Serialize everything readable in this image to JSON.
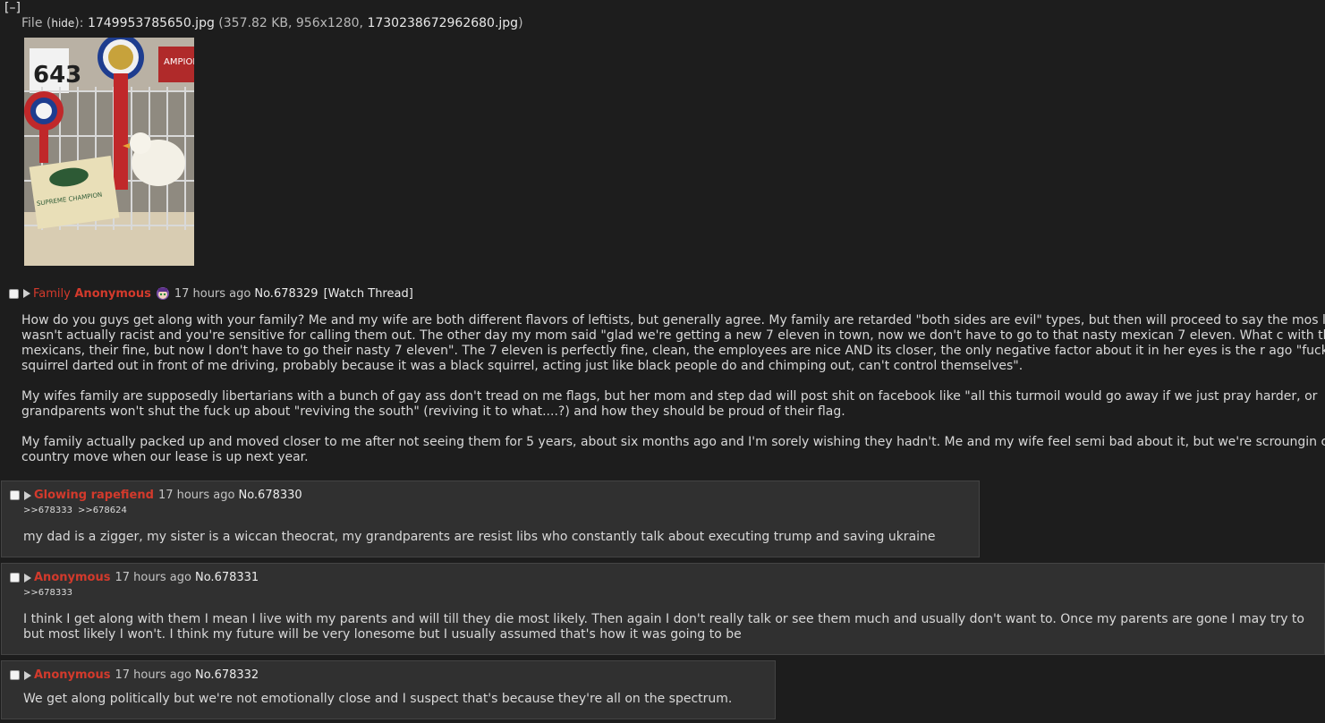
{
  "collapse_label": "[–]",
  "file": {
    "prefix": "File (",
    "hide_label": "hide",
    "mid": "): ",
    "filename": "1749953785650.jpg",
    "meta": " (357.82 KB, 956x1280, ",
    "original_name": "1730238672962680.jpg",
    "suffix": ")"
  },
  "thumbnail_texts": {
    "number": "643",
    "card_title": "SUPREME CHAMPION",
    "banner": "AMPION"
  },
  "op": {
    "subject": "Family",
    "name": "Anonymous",
    "flag_icon": "anime-character-flag-icon",
    "time": "17 hours ago",
    "number": "No.678329",
    "watch": "[Watch Thread]",
    "paragraphs": [
      "How do you guys get along with your family? Me and my wife are both different flavors of leftists, but generally agree. My family are retarded \"both sides are evil\" types, but then will proceed to say the mos like it wasn't actually racist and you're sensitive for calling them out. The other day my mom said \"glad we're getting a new 7 eleven in town, now we don't have to go to that nasty mexican 7 eleven. What c with the mexicans, their fine, but now I don't have to go their nasty 7 eleven\". The 7 eleven is perfectly fine, clean, the employees are nice AND its closer, the only negative factor about it in her eyes is the r ago \"fucking squirrel darted out in front of me driving, probably because it was a black squirrel, acting just like black people do and chimping out, can't control themselves\".",
      "My wifes family are supposedly libertarians with a bunch of gay ass don't tread on me flags, but her mom and step dad will post shit on facebook like \"all this turmoil would go away if we just pray harder, or grandparents won't shut the fuck up about \"reviving the south\" (reviving it to what....?) and how they should be proud of their flag.",
      "My family actually packed up and moved closer to me after not seeing them for 5 years, about six months ago and I'm sorely wishing they hadn't. Me and my wife feel semi bad about it, but we're scroungin cross country move when our lease is up next year."
    ]
  },
  "replies": [
    {
      "name": "Glowing rapefiend",
      "time": "17 hours ago",
      "number": "No.678330",
      "backlinks": [
        ">>678333",
        ">>678624"
      ],
      "text": "my dad is a zigger, my sister is a wiccan theocrat, my grandparents are resist libs who constantly talk about executing trump and saving ukraine"
    },
    {
      "name": "Anonymous",
      "time": "17 hours ago",
      "number": "No.678331",
      "quote": ">>678333",
      "text": "I think I get along with them I mean I live with my parents and will till they die most likely. Then again I don't really talk or see them much and usually don't want to. Once my parents are gone I may try to but most likely I won't. I think my future will be very lonesome but I usually assumed that's how it was going to be"
    },
    {
      "name": "Anonymous",
      "time": "17 hours ago",
      "number": "No.678332",
      "text": "We get along politically but we're not emotionally close and I suspect that's because they're all on the spectrum."
    }
  ]
}
